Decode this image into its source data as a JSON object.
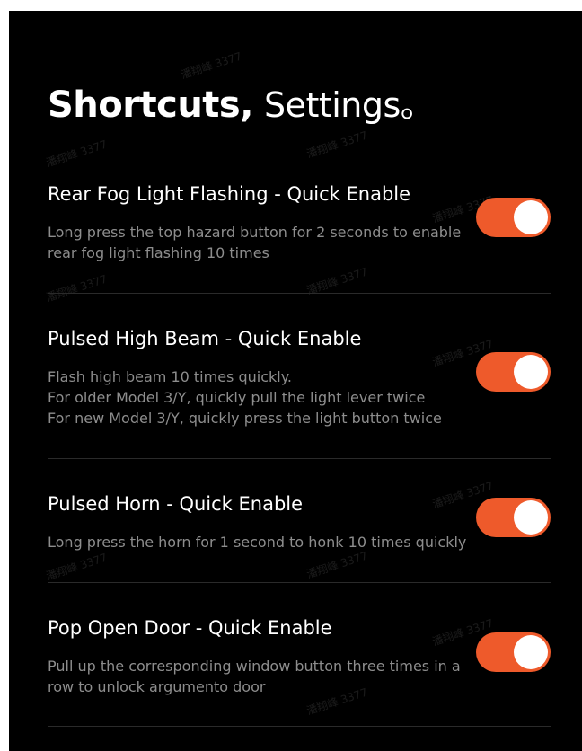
{
  "header": {
    "title_bold": "Shortcuts,",
    "title_light": "Settings。"
  },
  "settings": [
    {
      "title": "Rear Fog Light Flashing - Quick Enable",
      "description_lines": [
        "Long press the top hazard button for 2 seconds to enable",
        "rear fog light flashing 10 times"
      ],
      "enabled": true
    },
    {
      "title": "Pulsed High Beam - Quick Enable",
      "description_lines": [
        "Flash high beam 10 times quickly.",
        "For older Model 3/Y, quickly pull the light lever twice",
        "For new Model 3/Y, quickly press the light button twice"
      ],
      "enabled": true
    },
    {
      "title": "Pulsed Horn - Quick Enable",
      "description_lines": [
        "Long press the horn for 1 second to honk 10 times quickly"
      ],
      "enabled": true
    },
    {
      "title": "Pop Open Door - Quick Enable",
      "description_lines": [
        "Pull up the corresponding window button three times in a",
        "row to unlock argumento door"
      ],
      "enabled": true
    }
  ],
  "watermark": {
    "text": "潘翔峰 3377"
  },
  "colors": {
    "background": "#000000",
    "toggle_on": "#ee5a2b",
    "title_text": "#ffffff",
    "description_text": "#8d8d8d"
  }
}
